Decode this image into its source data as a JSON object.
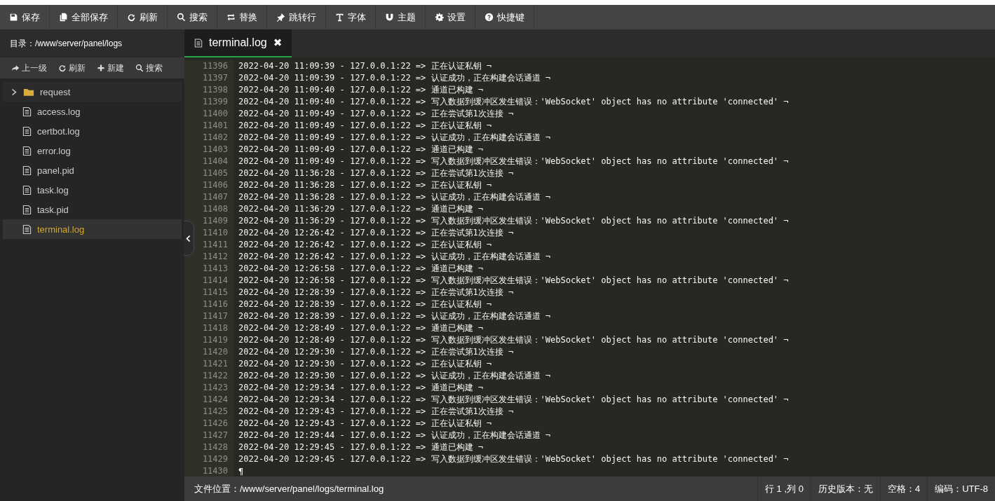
{
  "toolbar": [
    {
      "label": "保存"
    },
    {
      "label": "全部保存"
    },
    {
      "label": "刷新"
    },
    {
      "label": "搜索"
    },
    {
      "label": "替换"
    },
    {
      "label": "跳转行"
    },
    {
      "label": "字体"
    },
    {
      "label": "主题"
    },
    {
      "label": "设置"
    },
    {
      "label": "快捷键"
    }
  ],
  "sidebar": {
    "path": "目录：/www/server/panel/logs",
    "actions": [
      {
        "label": "上一级"
      },
      {
        "label": "刷新"
      },
      {
        "label": "新建"
      },
      {
        "label": "搜索"
      }
    ],
    "items": [
      {
        "kind": "folder",
        "name": "request",
        "selected": false
      },
      {
        "kind": "file",
        "name": "access.log",
        "selected": false
      },
      {
        "kind": "file",
        "name": "certbot.log",
        "selected": false
      },
      {
        "kind": "file",
        "name": "error.log",
        "selected": false
      },
      {
        "kind": "file",
        "name": "panel.pid",
        "selected": false
      },
      {
        "kind": "file",
        "name": "task.log",
        "selected": false
      },
      {
        "kind": "file",
        "name": "task.pid",
        "selected": false
      },
      {
        "kind": "file",
        "name": "terminal.log",
        "selected": true
      }
    ]
  },
  "tabs": [
    {
      "label": "terminal.log",
      "close": "✖",
      "selected": true
    }
  ],
  "editor": {
    "lines": [
      {
        "num": "11396",
        "text": "2022-04-20 11:09:39 - 127.0.0.1:22 => 正在认证私钥 ¬"
      },
      {
        "num": "11397",
        "text": "2022-04-20 11:09:39 - 127.0.0.1:22 => 认证成功，正在构建会话通道 ¬"
      },
      {
        "num": "11398",
        "text": "2022-04-20 11:09:40 - 127.0.0.1:22 => 通道已构建 ¬"
      },
      {
        "num": "11399",
        "text": "2022-04-20 11:09:40 - 127.0.0.1:22 => 写入数据到缓冲区发生错误：'WebSocket' object has no attribute 'connected' ¬"
      },
      {
        "num": "11400",
        "text": "2022-04-20 11:09:49 - 127.0.0.1:22 => 正在尝试第1次连接 ¬"
      },
      {
        "num": "11401",
        "text": "2022-04-20 11:09:49 - 127.0.0.1:22 => 正在认证私钥 ¬"
      },
      {
        "num": "11402",
        "text": "2022-04-20 11:09:49 - 127.0.0.1:22 => 认证成功，正在构建会话通道 ¬"
      },
      {
        "num": "11403",
        "text": "2022-04-20 11:09:49 - 127.0.0.1:22 => 通道已构建 ¬"
      },
      {
        "num": "11404",
        "text": "2022-04-20 11:09:49 - 127.0.0.1:22 => 写入数据到缓冲区发生错误：'WebSocket' object has no attribute 'connected' ¬"
      },
      {
        "num": "11405",
        "text": "2022-04-20 11:36:28 - 127.0.0.1:22 => 正在尝试第1次连接 ¬"
      },
      {
        "num": "11406",
        "text": "2022-04-20 11:36:28 - 127.0.0.1:22 => 正在认证私钥 ¬"
      },
      {
        "num": "11407",
        "text": "2022-04-20 11:36:28 - 127.0.0.1:22 => 认证成功，正在构建会话通道 ¬"
      },
      {
        "num": "11408",
        "text": "2022-04-20 11:36:29 - 127.0.0.1:22 => 通道已构建 ¬"
      },
      {
        "num": "11409",
        "text": "2022-04-20 11:36:29 - 127.0.0.1:22 => 写入数据到缓冲区发生错误：'WebSocket' object has no attribute 'connected' ¬"
      },
      {
        "num": "11410",
        "text": "2022-04-20 12:26:42 - 127.0.0.1:22 => 正在尝试第1次连接 ¬"
      },
      {
        "num": "11411",
        "text": "2022-04-20 12:26:42 - 127.0.0.1:22 => 正在认证私钥 ¬"
      },
      {
        "num": "11412",
        "text": "2022-04-20 12:26:42 - 127.0.0.1:22 => 认证成功，正在构建会话通道 ¬"
      },
      {
        "num": "11413",
        "text": "2022-04-20 12:26:58 - 127.0.0.1:22 => 通道已构建 ¬"
      },
      {
        "num": "11414",
        "text": "2022-04-20 12:26:58 - 127.0.0.1:22 => 写入数据到缓冲区发生错误：'WebSocket' object has no attribute 'connected' ¬"
      },
      {
        "num": "11415",
        "text": "2022-04-20 12:28:39 - 127.0.0.1:22 => 正在尝试第1次连接 ¬"
      },
      {
        "num": "11416",
        "text": "2022-04-20 12:28:39 - 127.0.0.1:22 => 正在认证私钥 ¬"
      },
      {
        "num": "11417",
        "text": "2022-04-20 12:28:39 - 127.0.0.1:22 => 认证成功，正在构建会话通道 ¬"
      },
      {
        "num": "11418",
        "text": "2022-04-20 12:28:49 - 127.0.0.1:22 => 通道已构建 ¬"
      },
      {
        "num": "11419",
        "text": "2022-04-20 12:28:49 - 127.0.0.1:22 => 写入数据到缓冲区发生错误：'WebSocket' object has no attribute 'connected' ¬"
      },
      {
        "num": "11420",
        "text": "2022-04-20 12:29:30 - 127.0.0.1:22 => 正在尝试第1次连接 ¬"
      },
      {
        "num": "11421",
        "text": "2022-04-20 12:29:30 - 127.0.0.1:22 => 正在认证私钥 ¬"
      },
      {
        "num": "11422",
        "text": "2022-04-20 12:29:30 - 127.0.0.1:22 => 认证成功，正在构建会话通道 ¬"
      },
      {
        "num": "11423",
        "text": "2022-04-20 12:29:34 - 127.0.0.1:22 => 通道已构建 ¬"
      },
      {
        "num": "11424",
        "text": "2022-04-20 12:29:34 - 127.0.0.1:22 => 写入数据到缓冲区发生错误：'WebSocket' object has no attribute 'connected' ¬"
      },
      {
        "num": "11425",
        "text": "2022-04-20 12:29:43 - 127.0.0.1:22 => 正在尝试第1次连接 ¬"
      },
      {
        "num": "11426",
        "text": "2022-04-20 12:29:43 - 127.0.0.1:22 => 正在认证私钥 ¬"
      },
      {
        "num": "11427",
        "text": "2022-04-20 12:29:44 - 127.0.0.1:22 => 认证成功，正在构建会话通道 ¬"
      },
      {
        "num": "11428",
        "text": "2022-04-20 12:29:45 - 127.0.0.1:22 => 通道已构建 ¬"
      },
      {
        "num": "11429",
        "text": "2022-04-20 12:29:45 - 127.0.0.1:22 => 写入数据到缓冲区发生错误：'WebSocket' object has no attribute 'connected' ¬"
      },
      {
        "num": "11430",
        "text": "¶"
      }
    ]
  },
  "status_bar": {
    "file": "文件位置：/www/server/panel/logs/terminal.log",
    "position": "行 1 ,列 0",
    "history": "历史版本：无",
    "indent": "空格：4",
    "encoding": "编码：UTF-8"
  }
}
